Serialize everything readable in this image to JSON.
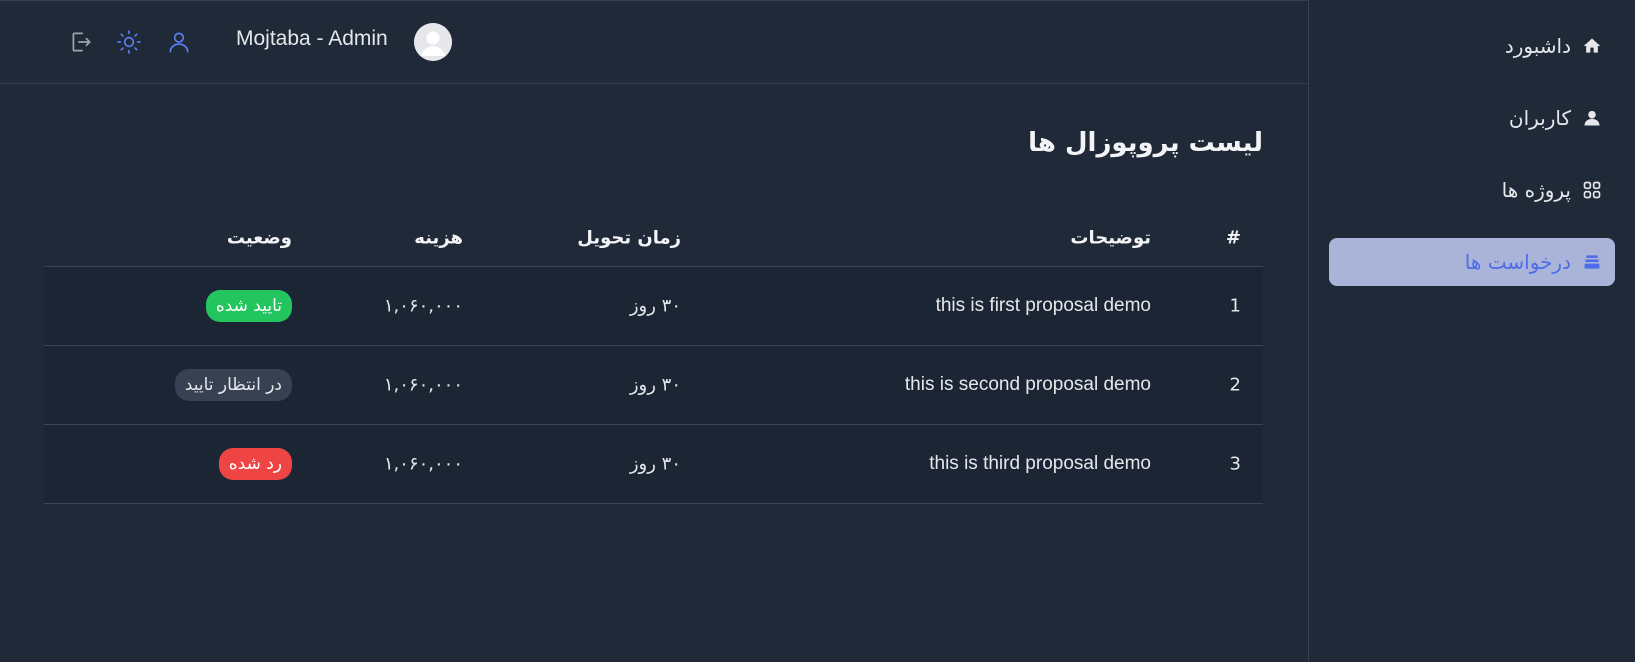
{
  "header": {
    "username": "Mojtaba - Admin",
    "icons": [
      "logout-icon",
      "sun-icon",
      "user-icon"
    ]
  },
  "sidebar": {
    "items": [
      {
        "label": "داشبورد",
        "icon": "home-icon",
        "active": false
      },
      {
        "label": "کاربران",
        "icon": "user-icon",
        "active": false
      },
      {
        "label": "پروژه ها",
        "icon": "grid-icon",
        "active": false
      },
      {
        "label": "درخواست ها",
        "icon": "stack-icon",
        "active": true
      }
    ]
  },
  "main": {
    "title": "لیست پروپوزال ها",
    "columns": [
      "#",
      "توضیحات",
      "زمان تحویل",
      "هزینه",
      "وضعیت"
    ],
    "rows": [
      {
        "num": "1",
        "description": "this is first proposal demo",
        "delivery": "۳۰ روز",
        "cost": "۱,۰۶۰,۰۰۰",
        "status": "تایید شده",
        "status_color": "#22c55e"
      },
      {
        "num": "2",
        "description": "this is second proposal demo",
        "delivery": "۳۰ روز",
        "cost": "۱,۰۶۰,۰۰۰",
        "status": "در انتظار تایید",
        "status_color": "#374151"
      },
      {
        "num": "3",
        "description": "this is third proposal demo",
        "delivery": "۳۰ روز",
        "cost": "۱,۰۶۰,۰۰۰",
        "status": "رد شده",
        "status_color": "#ef4444"
      }
    ]
  },
  "colors": {
    "background": "#1f2937",
    "accent": "#4f6ce8",
    "active_nav_bg": "#a9b4d8"
  }
}
